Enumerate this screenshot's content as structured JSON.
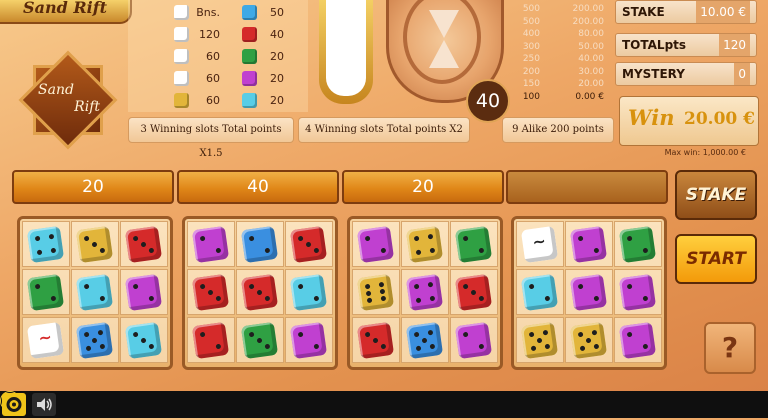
{
  "logo": {
    "top_text": "Sand Rift",
    "main_line1": "Sand",
    "main_line2": "Rift"
  },
  "paytable": {
    "left": [
      {
        "value": "Bns.",
        "icon": "kanji-green-die-icon",
        "color": "#ffffff"
      },
      {
        "value": "120",
        "icon": "kanji-red-die-icon",
        "color": "#ffffff"
      },
      {
        "value": "60",
        "icon": "kanji-blue-die-icon",
        "color": "#ffffff"
      },
      {
        "value": "60",
        "icon": "kanji-black-die-icon",
        "color": "#ffffff"
      },
      {
        "value": "60",
        "icon": "yellow-die-icon",
        "color": "#e2b53a"
      }
    ],
    "right": [
      {
        "value": "50",
        "icon": "blue-die-icon",
        "color": "#3fa9e6"
      },
      {
        "value": "40",
        "icon": "red-die-icon",
        "color": "#d52a2a"
      },
      {
        "value": "20",
        "icon": "green-die-icon",
        "color": "#2fa043"
      },
      {
        "value": "20",
        "icon": "magenta-die-icon",
        "color": "#c040d0"
      },
      {
        "value": "20",
        "icon": "cyan-die-icon",
        "color": "#58cde6"
      }
    ]
  },
  "banners": {
    "b1": "3 Winning slots Total points X1.5",
    "b2": "4 Winning slots Total points X2",
    "b3": "9 Alike 200 points"
  },
  "counter": "40",
  "multiplier_table": [
    {
      "points": "500",
      "prize": "200.00"
    },
    {
      "points": "500",
      "prize": "200.00"
    },
    {
      "points": "400",
      "prize": "80.00"
    },
    {
      "points": "300",
      "prize": "50.00"
    },
    {
      "points": "250",
      "prize": "40.00"
    },
    {
      "points": "200",
      "prize": "30.00"
    },
    {
      "points": "150",
      "prize": "20.00"
    },
    {
      "points": "100",
      "prize": "0.00 €"
    }
  ],
  "info": {
    "stake_label": "STAKE",
    "stake_value": "10.00 €",
    "total_label": "TOTALpts",
    "total_value": "120",
    "mystery_label": "MYSTERY",
    "mystery_value": "0",
    "win_label": "Win",
    "win_value": "20.00 €",
    "max_win": "Max win: 1,000.00 €"
  },
  "slots": [
    {
      "header": "20",
      "dice": [
        [
          "cyan",
          4
        ],
        [
          "yellow",
          3
        ],
        [
          "red",
          3
        ],
        [
          "green",
          2
        ],
        [
          "cyan",
          2
        ],
        [
          "magenta",
          2
        ],
        [
          "kanji-red",
          0
        ],
        [
          "blue",
          5
        ],
        [
          "cyan",
          3
        ]
      ]
    },
    {
      "header": "40",
      "dice": [
        [
          "magenta",
          2
        ],
        [
          "blue",
          2
        ],
        [
          "red",
          3
        ],
        [
          "red",
          3
        ],
        [
          "red",
          3
        ],
        [
          "cyan",
          2
        ],
        [
          "red",
          2
        ],
        [
          "green",
          3
        ],
        [
          "magenta",
          2
        ]
      ]
    },
    {
      "header": "20",
      "dice": [
        [
          "magenta",
          2
        ],
        [
          "yellow",
          4
        ],
        [
          "green",
          2
        ],
        [
          "yellow",
          6
        ],
        [
          "magenta",
          4
        ],
        [
          "red",
          3
        ],
        [
          "red",
          3
        ],
        [
          "blue",
          5
        ],
        [
          "magenta",
          2
        ]
      ]
    },
    {
      "header": "",
      "dice": [
        [
          "kanji-black",
          0
        ],
        [
          "magenta",
          2
        ],
        [
          "green",
          2
        ],
        [
          "cyan",
          2
        ],
        [
          "magenta",
          2
        ],
        [
          "magenta",
          2
        ],
        [
          "yellow",
          5
        ],
        [
          "yellow",
          5
        ],
        [
          "magenta",
          2
        ]
      ]
    }
  ],
  "colors": {
    "cyan": "#58cde6",
    "yellow": "#e2b53a",
    "red": "#d52a2a",
    "green": "#2fa043",
    "magenta": "#c040d0",
    "blue": "#3a8fe0",
    "kanji-red": "#ffffff",
    "kanji-black": "#ffffff"
  },
  "buttons": {
    "stake": "STAKE",
    "start": "START",
    "help": "?"
  },
  "bottom_bar": {
    "info_symbol": "i",
    "gear": "gear-icon",
    "sound": "sound-icon"
  }
}
